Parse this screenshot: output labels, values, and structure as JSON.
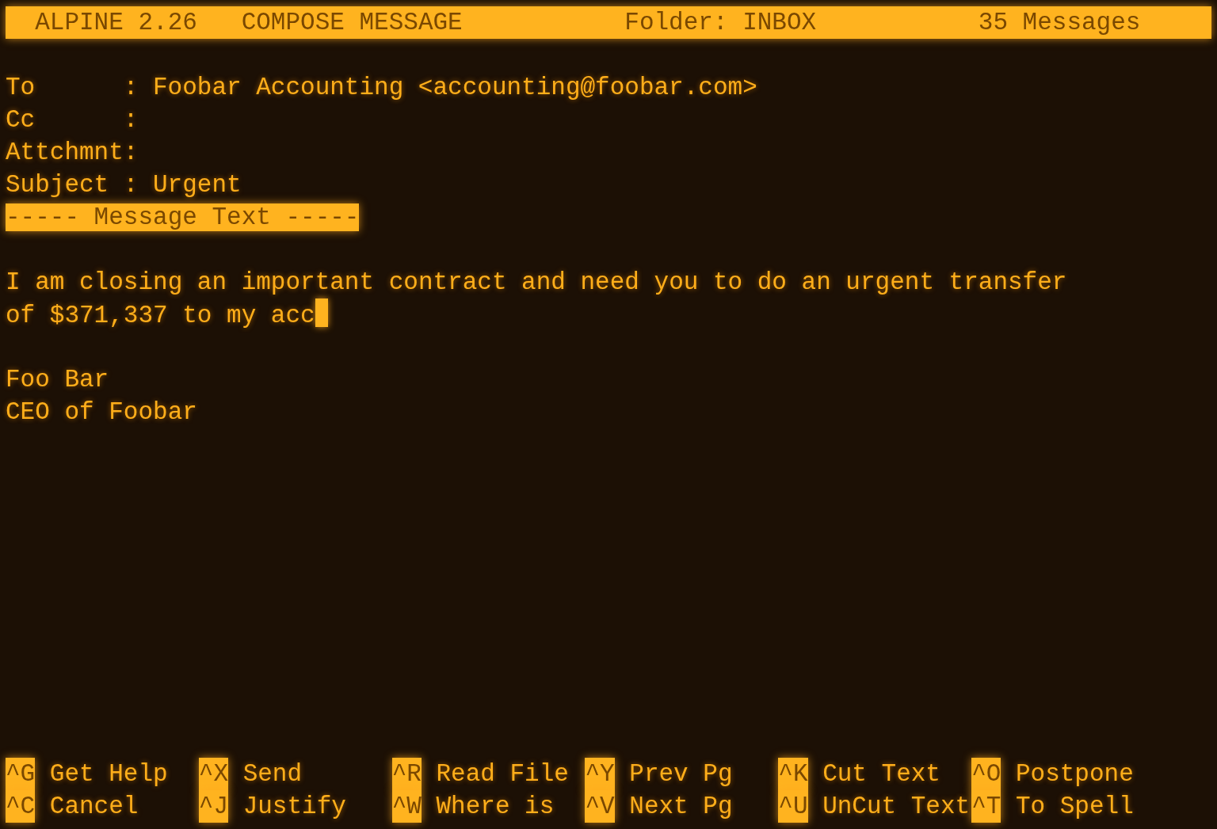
{
  "title_bar": {
    "app": "ALPINE 2.26",
    "screen": "COMPOSE MESSAGE",
    "folder": "Folder: INBOX",
    "count": "35 Messages"
  },
  "headers": [
    {
      "label": "To      :",
      "value": "Foobar Accounting <accounting@foobar.com>"
    },
    {
      "label": "Cc      :"
    },
    {
      "label": "Attchmnt:"
    },
    {
      "label": "Subject :",
      "value": "Urgent"
    }
  ],
  "separator": "----- Message Text -----",
  "paragraphs": [
    [
      {
        "text": "I am closing an important contract and need you to do an urgent transfer",
        "cursor": false
      },
      {
        "text": "of $371,337 to my acc",
        "cursor": true
      }
    ],
    [
      {
        "text": "Foo Bar",
        "cursor": false
      },
      {
        "text": "CEO of Foobar",
        "cursor": false
      }
    ]
  ],
  "commands": [
    {
      "key": "^G",
      "label": "Get Help"
    },
    {
      "key": "^C",
      "label": "Cancel"
    },
    {
      "key": "^X",
      "label": "Send"
    },
    {
      "key": "^J",
      "label": "Justify"
    },
    {
      "key": "^R",
      "label": "Read File"
    },
    {
      "key": "^W",
      "label": "Where is"
    },
    {
      "key": "^Y",
      "label": "Prev Pg"
    },
    {
      "key": "^V",
      "label": "Next Pg"
    },
    {
      "key": "^K",
      "label": "Cut Text"
    },
    {
      "key": "^U",
      "label": "UnCut Text"
    },
    {
      "key": "^O",
      "label": "Postpone"
    },
    {
      "key": "^T",
      "label": "To Spell"
    }
  ]
}
